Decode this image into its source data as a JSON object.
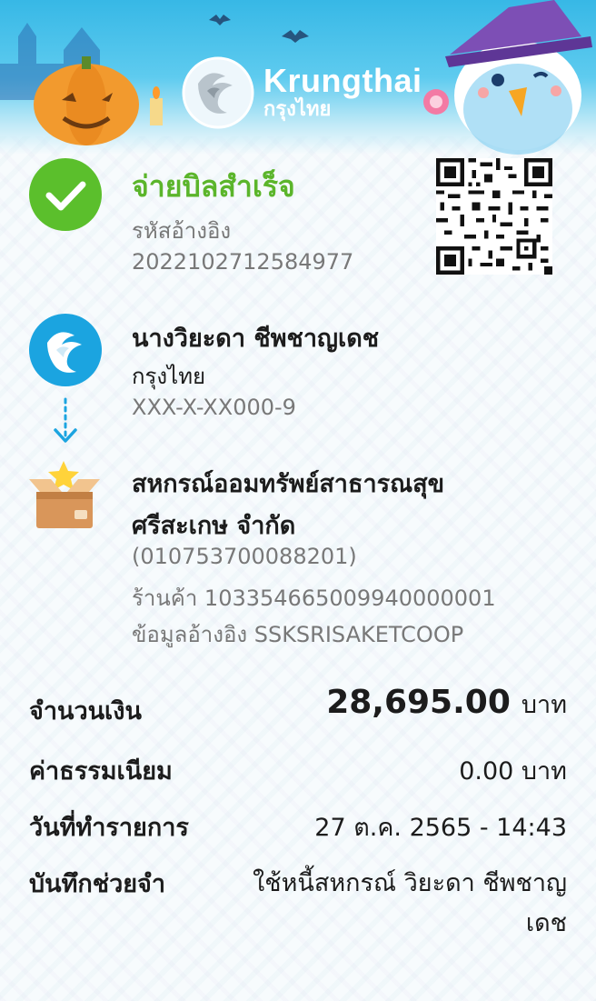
{
  "brand": {
    "name_en": "Krungthai",
    "name_th": "กรุงไทย",
    "primary_color": "#1ba4e0",
    "success_color": "#5bb52b"
  },
  "status": {
    "title": "จ่ายบิลสำเร็จ",
    "ref_label": "รหัสอ้างอิง",
    "ref_value": "2022102712584977",
    "icon": "check-icon"
  },
  "sender": {
    "name": "นางวิยะดา ชีพชาญเดช",
    "bank": "กรุงไทย",
    "account": "XXX-X-XX000-9",
    "icon": "krungthai-logo-icon"
  },
  "payee": {
    "name_line1": "สหกรณ์ออมทรัพย์สาธารณสุข",
    "name_line2": "ศรีสะเกษ จำกัด",
    "tax_id": "(010753700088201)",
    "store": "ร้านค้า 103354665009940000001",
    "reference": "ข้อมูลอ้างอิง SSKSRISAKETCOOP",
    "icon": "box-star-icon"
  },
  "details": {
    "amount_label": "จำนวนเงิน",
    "amount_value": "28,695.00",
    "amount_unit": "บาท",
    "fee_label": "ค่าธรรมเนียม",
    "fee_value": "0.00 บาท",
    "date_label": "วันที่ทำรายการ",
    "date_value": "27 ต.ค. 2565 - 14:43",
    "memo_label": "บันทึกช่วยจำ",
    "memo_value": "ใช้หนี้สหกรณ์ วิยะดา ชีพชาญ เดช"
  }
}
